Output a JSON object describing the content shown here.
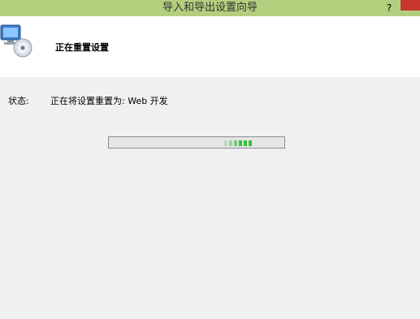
{
  "window": {
    "title": "导入和导出设置向导",
    "help_label": "?"
  },
  "header": {
    "title": "正在重置设置",
    "icon": "computer-disc-icon"
  },
  "status": {
    "label": "状态:",
    "text": "正在将设置重置为: Web 开发"
  },
  "progress": {
    "mode": "indeterminate",
    "color": "#36c13c"
  },
  "colors": {
    "titlebar": "#b3cf7e",
    "close": "#c7372f"
  }
}
